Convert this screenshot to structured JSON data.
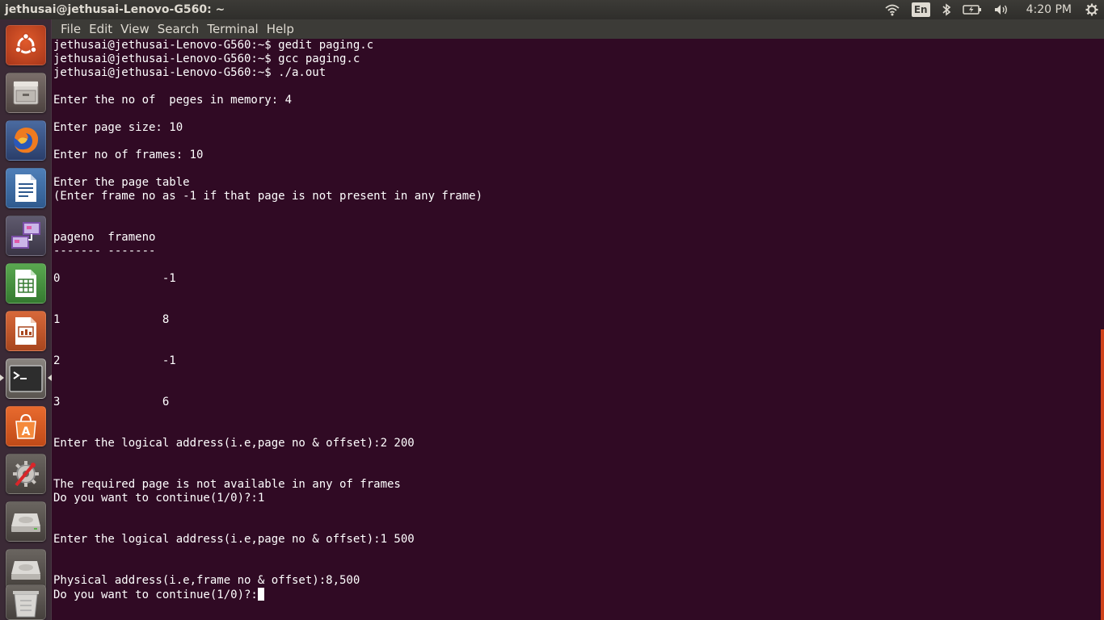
{
  "top_panel": {
    "window_title": "jethusai@jethusai-Lenovo-G560: ~",
    "keyboard_layout": "En",
    "clock": "4:20 PM"
  },
  "launcher": {
    "items": [
      {
        "name": "ubuntu-dash-icon"
      },
      {
        "name": "files-icon"
      },
      {
        "name": "firefox-icon"
      },
      {
        "name": "libreoffice-writer-icon"
      },
      {
        "name": "remote-desktop-icon"
      },
      {
        "name": "libreoffice-calc-icon"
      },
      {
        "name": "libreoffice-impress-icon"
      },
      {
        "name": "terminal-icon"
      },
      {
        "name": "software-center-icon"
      },
      {
        "name": "system-settings-icon"
      },
      {
        "name": "drive-icon"
      },
      {
        "name": "drive-icon"
      },
      {
        "name": "trash-icon"
      }
    ]
  },
  "menubar": {
    "items": [
      "File",
      "Edit",
      "View",
      "Search",
      "Terminal",
      "Help"
    ]
  },
  "terminal": {
    "lines": [
      "jethusai@jethusai-Lenovo-G560:~$ gedit paging.c",
      "jethusai@jethusai-Lenovo-G560:~$ gcc paging.c",
      "jethusai@jethusai-Lenovo-G560:~$ ./a.out",
      "",
      "Enter the no of  peges in memory: 4",
      "",
      "Enter page size: 10",
      "",
      "Enter no of frames: 10",
      "",
      "Enter the page table",
      "(Enter frame no as -1 if that page is not present in any frame)",
      "",
      "",
      "pageno  frameno",
      "------- -------",
      "",
      "0               -1",
      "",
      "",
      "1               8",
      "",
      "",
      "2               -1",
      "",
      "",
      "3               6",
      "",
      "",
      "Enter the logical address(i.e,page no & offset):2 200",
      "",
      "",
      "The required page is not available in any of frames",
      "Do you want to continue(1/0)?:1",
      "",
      "",
      "Enter the logical address(i.e,page no & offset):1 500",
      "",
      "",
      "Physical address(i.e,frame no & offset):8,500",
      "Do you want to continue(1/0)?:"
    ]
  },
  "colors": {
    "terminal_bg": "#300a24",
    "panel_bg": "#3c3b37",
    "panel_text": "#dfdbd2",
    "scrollbar": "#d0431c"
  }
}
